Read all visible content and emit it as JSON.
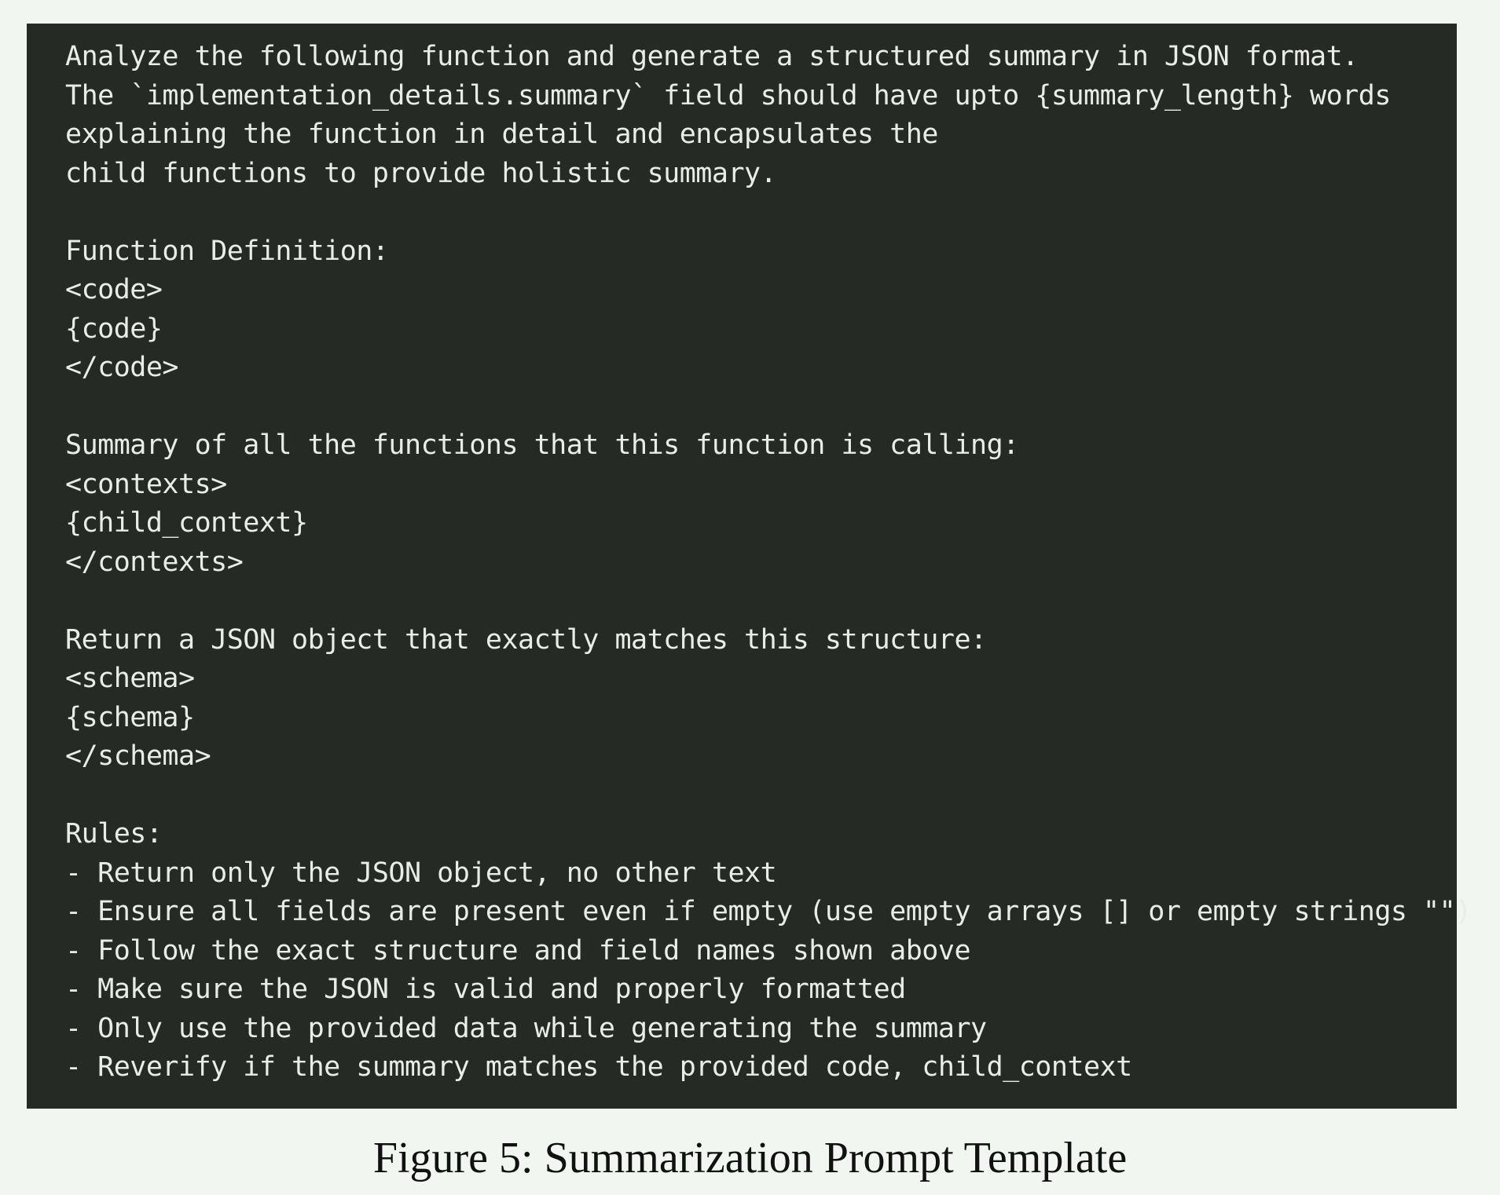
{
  "prompt_template": {
    "intro": [
      "Analyze the following function and generate a structured summary in JSON format.",
      "The `implementation_details.summary` field should have upto {summary_length} words",
      "explaining the function in detail and encapsulates the",
      "child functions to provide holistic summary."
    ],
    "function_definition": {
      "heading": "Function Definition:",
      "open_tag": "<code>",
      "placeholder": "{code}",
      "close_tag": "</code>"
    },
    "child_summaries": {
      "heading": "Summary of all the functions that this function is calling:",
      "open_tag": "<contexts>",
      "placeholder": "{child_context}",
      "close_tag": "</contexts>"
    },
    "schema_section": {
      "heading": "Return a JSON object that exactly matches this structure:",
      "open_tag": "<schema>",
      "placeholder": "{schema}",
      "close_tag": "</schema>"
    },
    "rules": {
      "heading": "Rules:",
      "items": [
        "- Return only the JSON object, no other text",
        "- Ensure all fields are present even if empty (use empty arrays [] or empty strings \"\")",
        "- Follow the exact structure and field names shown above",
        "- Make sure the JSON is valid and properly formatted",
        "- Only use the provided data while generating the summary",
        "- Reverify if the summary matches the provided code, child_context"
      ]
    }
  },
  "caption": "Figure 5: Summarization Prompt Template"
}
